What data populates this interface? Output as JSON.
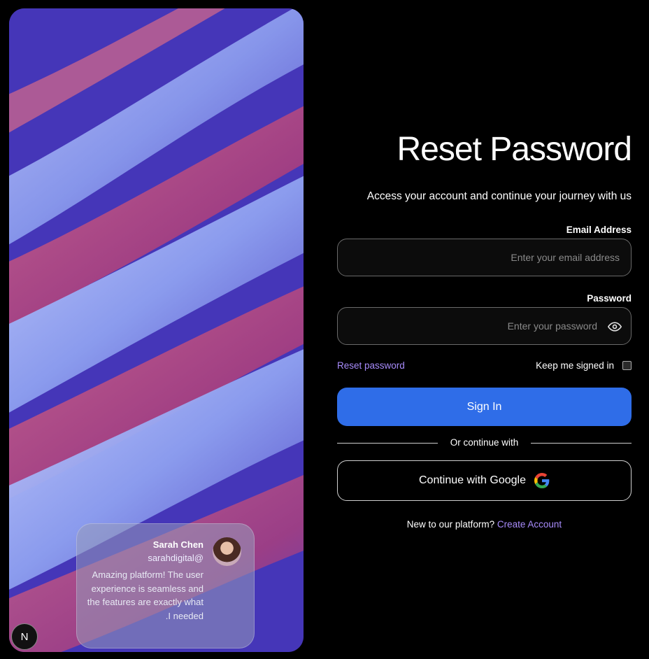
{
  "hero": {
    "testimonial": {
      "name": "Sarah Chen",
      "handle": "sarahdigital@",
      "quote": "Amazing platform! The user experience is seamless and the features are exactly what .I needed"
    },
    "badge": "N"
  },
  "form": {
    "title": "Reset Password",
    "subtitle": "Access your account and continue your journey with us",
    "email": {
      "label": "Email Address",
      "value": "",
      "placeholder": "Enter your email address"
    },
    "password": {
      "label": "Password",
      "value": "",
      "placeholder": "Enter your password"
    },
    "reset_link": "Reset password",
    "keep_signed_in": "Keep me signed in",
    "keep_signed_in_checked": false,
    "sign_in_label": "Sign In",
    "divider_text": "Or continue with",
    "google_label": "Continue with Google",
    "signup_prompt": "New to our platform?",
    "signup_link": "Create Account"
  },
  "colors": {
    "accent": "#2f6de8",
    "link": "#a78bfa",
    "background": "#000000"
  }
}
